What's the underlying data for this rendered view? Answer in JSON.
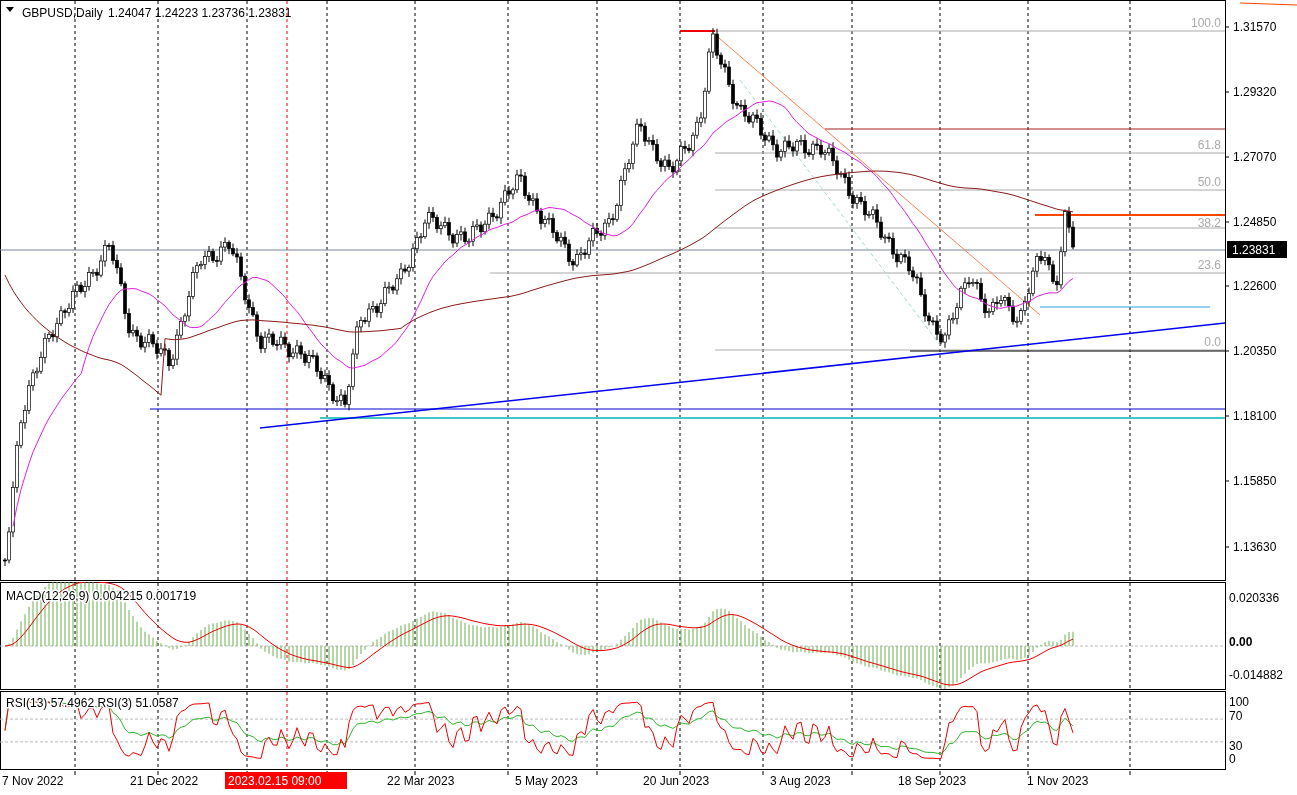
{
  "header": {
    "symbol": "GBPUSD,Daily",
    "ohlc": "1.24047 1.24223 1.23736 1.23831"
  },
  "price_axis": {
    "ticks": [
      "1.31570",
      "1.29320",
      "1.27070",
      "1.24850",
      "1.22600",
      "1.20350",
      "1.18100",
      "1.15850",
      "1.13630"
    ],
    "current_price": "1.23831"
  },
  "fibonacci": {
    "levels": [
      "100.0",
      "61.8",
      "50.0",
      "38.2",
      "23.6",
      "0.0"
    ]
  },
  "macd": {
    "title": "MACD(12,26,9) 0.004215 0.001719",
    "ticks": [
      "0.020336",
      "0.00",
      "-0.014882"
    ]
  },
  "rsi": {
    "title": "RSI(13) 57.4962  RSI(3) 51.0587",
    "ticks": [
      "100",
      "70",
      "30",
      "0"
    ]
  },
  "time_axis": {
    "labels": [
      {
        "text": "7 Nov 2022",
        "kind": "date"
      },
      {
        "text": "21 Dec 2022",
        "kind": "date"
      },
      {
        "text": "2023.02.15 09:00",
        "kind": "cursor"
      },
      {
        "text": "22 Mar 2023",
        "kind": "date"
      },
      {
        "text": "5 May 2023",
        "kind": "date"
      },
      {
        "text": "20 Jun 2023",
        "kind": "date"
      },
      {
        "text": "3 Aug 2023",
        "kind": "date"
      },
      {
        "text": "18 Sep 2023",
        "kind": "date"
      },
      {
        "text": "1 Nov 2023",
        "kind": "date"
      }
    ]
  }
}
